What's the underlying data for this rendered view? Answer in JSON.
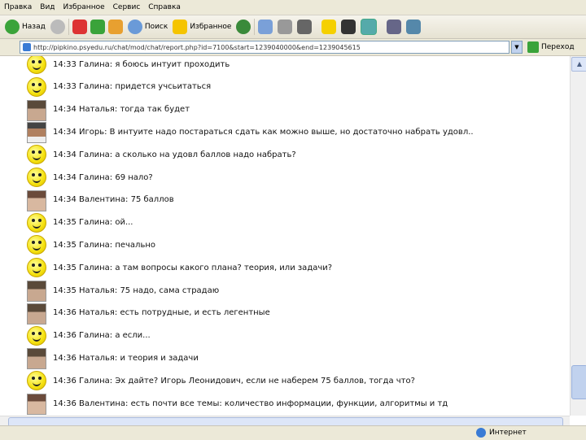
{
  "menu": [
    "Правка",
    "Вид",
    "Избранное",
    "Сервис",
    "Справка"
  ],
  "toolbar": {
    "back_label": "Назад",
    "search_label": "Поиск",
    "favorites_label": "Избранное"
  },
  "address": {
    "url": "http://pipkino.psyedu.ru/chat/mod/chat/report.php?id=7100&start=1239040000&end=1239045615",
    "go_label": "Переход"
  },
  "chat": [
    {
      "avatar": "smiley",
      "text": "14:33 Галина: я боюсь интуит проходить"
    },
    {
      "avatar": "smiley",
      "text": "14:33 Галина: придется учсьитаться"
    },
    {
      "avatar": "photo-a",
      "text": "14:34 Наталья: тогда так будет"
    },
    {
      "avatar": "photo-b",
      "text": "14:34 Игорь: В интуите надо постараться сдать как можно выше, но достаточно набрать удовл.."
    },
    {
      "avatar": "smiley",
      "text": "14:34 Галина: а сколько на удовл баллов надо набрать?"
    },
    {
      "avatar": "smiley",
      "text": "14:34 Галина: 69 нало?"
    },
    {
      "avatar": "photo-c",
      "text": "14:34 Валентина: 75 баллов"
    },
    {
      "avatar": "smiley",
      "text": "14:35 Галина: ой..."
    },
    {
      "avatar": "smiley",
      "text": "14:35 Галина: печально"
    },
    {
      "avatar": "smiley",
      "text": "14:35 Галина: а там вопросы какого плана? теория, или задачи?"
    },
    {
      "avatar": "photo-a",
      "text": "14:35 Наталья: 75 надо, сама страдаю"
    },
    {
      "avatar": "photo-a",
      "text": "14:36 Наталья: есть потрудные, и есть легентные"
    },
    {
      "avatar": "smiley",
      "text": "14:36 Галина: а если..."
    },
    {
      "avatar": "photo-a",
      "text": "14:36 Наталья: и теория и задачи"
    },
    {
      "avatar": "smiley",
      "text": "14:36 Галина: Эх дайте? Игорь Леонидович, если не наберем 75 баллов, тогда что?"
    },
    {
      "avatar": "photo-c",
      "text": "14:36 Валентина: есть почти все темы: количество информации, функции, алгоритмы и тд"
    }
  ],
  "status": {
    "zone": "Интернет"
  }
}
